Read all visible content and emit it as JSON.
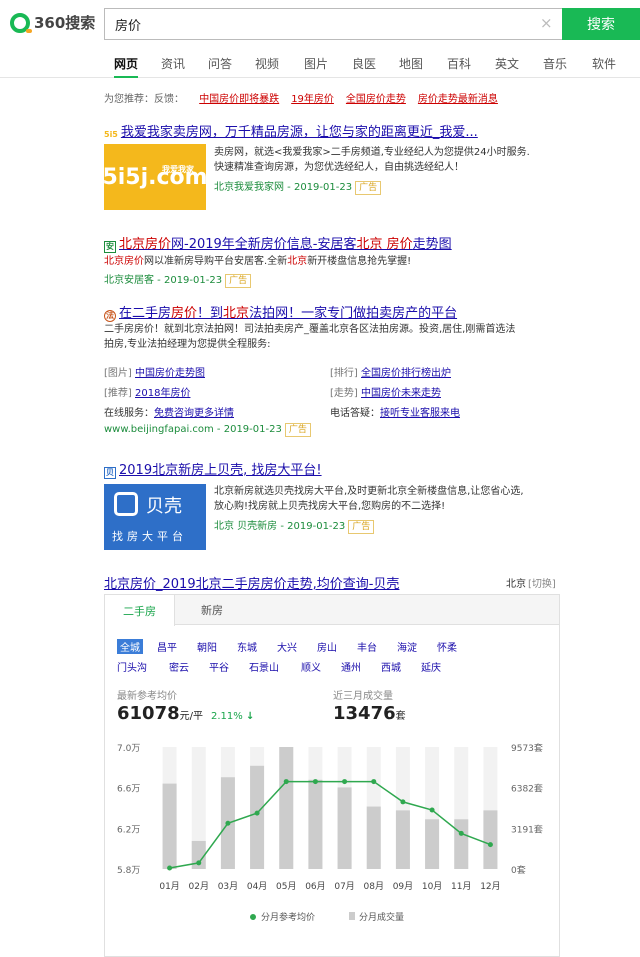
{
  "header": {
    "logo": "360搜索",
    "query": "房价",
    "clear": "×",
    "search_btn": "搜索"
  },
  "nav": [
    "网页",
    "资讯",
    "问答",
    "视频",
    "图片",
    "良医",
    "地图",
    "百科",
    "英文",
    "音乐",
    "软件"
  ],
  "recommend": {
    "label": "为您推荐：",
    "feedback": "反馈：",
    "items": [
      "中国房价即将暴跌",
      "19年房价",
      "全国房价走势",
      "房价走势最新消息"
    ]
  },
  "r1": {
    "icon": "5i5",
    "title": "我爱我家卖房网，万千精品房源，让您与家的距离更近_我爱...",
    "img_text": "5i5j.com",
    "img_small": "我爱我家",
    "desc1": "卖房网，就选<我爱我家>二手房频道,专业经纪人为您提供24小时服务.",
    "desc2": "快速精准查询房源，为您优选经纪人，自由挑选经纪人！",
    "url": "北京我爱我家网 - 2019-01-23",
    "ad": "广告"
  },
  "r2": {
    "icon": "安",
    "title_a": "北京房价",
    "title_b": "网-2019年全新房价信息-安居客",
    "title_c": "北京",
    "title_d": " 房价",
    "title_e": "走势图",
    "desc_a": "北京房价",
    "desc_b": "网以准新房导购平台安居客.全新",
    "desc_c": "北京",
    "desc_d": "新开楼盘信息抢先掌握!",
    "url": "北京安居客 - 2019-01-23",
    "ad": "广告"
  },
  "r3": {
    "icon": "法",
    "title_a": "在二手房",
    "title_b": "房价",
    "title_c": "！到",
    "title_d": "北京",
    "title_e": "法拍网！一家专门做拍卖房产的平台",
    "desc1": "二手房房价！就到北京法拍网！司法拍卖房产_覆盖北京各区法拍房源。投资,居住,刚需首选法",
    "desc2": "拍房,专业法拍经理为您提供全程服务:",
    "links": [
      [
        "[图片]",
        "中国房价走势图"
      ],
      [
        "[排行]",
        "全国房价排行榜出炉"
      ],
      [
        "[推荐]",
        "2018年房价"
      ],
      [
        "[走势]",
        "中国房价未来走势"
      ]
    ],
    "online_label": "在线服务：",
    "online_link": "免费咨询更多详情",
    "phone_label": "电话答疑：",
    "phone_link": "接听专业客服来电",
    "url": "www.beijingfapai.com - 2019-01-23",
    "ad": "广告"
  },
  "r4": {
    "icon": "贝",
    "title": "2019北京新房上贝壳, 找房大平台!",
    "img_text": "贝壳",
    "img_sub": "找房大平台",
    "desc1": "北京新房就选贝壳找房大平台,及时更新北京全新楼盘信息,让您省心选,",
    "desc2": "放心购!找房就上贝壳找房大平台,您购房的不二选择!",
    "url": "北京 贝壳新房 - 2019-01-23",
    "ad": "广告"
  },
  "r5": {
    "title": "北京房价_2019北京二手房房价走势,均价查询-贝壳",
    "city": "北京",
    "switch": "[切换]",
    "tabs": [
      "二手房",
      "新房"
    ],
    "districts": [
      "全城",
      "昌平",
      "朝阳",
      "东城",
      "大兴",
      "房山",
      "丰台",
      "海淀",
      "怀柔",
      "门头沟",
      "密云",
      "平谷",
      "石景山",
      "顺义",
      "通州",
      "西城",
      "延庆"
    ],
    "price_label": "最新参考均价",
    "price": "61078",
    "price_unit": "元/平",
    "pct": "2.11%",
    "vol_label": "近三月成交量",
    "vol": "13476",
    "vol_unit": "套"
  },
  "chart_data": {
    "type": "bar",
    "categories": [
      "01月",
      "02月",
      "03月",
      "04月",
      "05月",
      "06月",
      "07月",
      "08月",
      "09月",
      "10月",
      "11月",
      "12月"
    ],
    "y_left": {
      "ticks": [
        "7.0万",
        "6.6万",
        "6.2万",
        "5.8万"
      ],
      "range": [
        5.8,
        7.0
      ]
    },
    "y_right": {
      "ticks": [
        "9573套",
        "6382套",
        "3191套",
        "0套"
      ],
      "range": [
        0,
        9573
      ]
    },
    "series": [
      {
        "name": "分月成交量",
        "type": "bar",
        "values": [
          6700,
          2200,
          7200,
          8100,
          9573,
          7000,
          6400,
          4900,
          4600,
          3900,
          3900,
          4600
        ]
      },
      {
        "name": "分月参考均价",
        "type": "line",
        "values": [
          5.81,
          5.86,
          6.25,
          6.35,
          6.66,
          6.66,
          6.66,
          6.66,
          6.46,
          6.38,
          6.15,
          6.04
        ]
      }
    ],
    "colors": {
      "bar": "#cccccc",
      "line": "#2fa84f",
      "col": "#f2f2f2"
    }
  }
}
